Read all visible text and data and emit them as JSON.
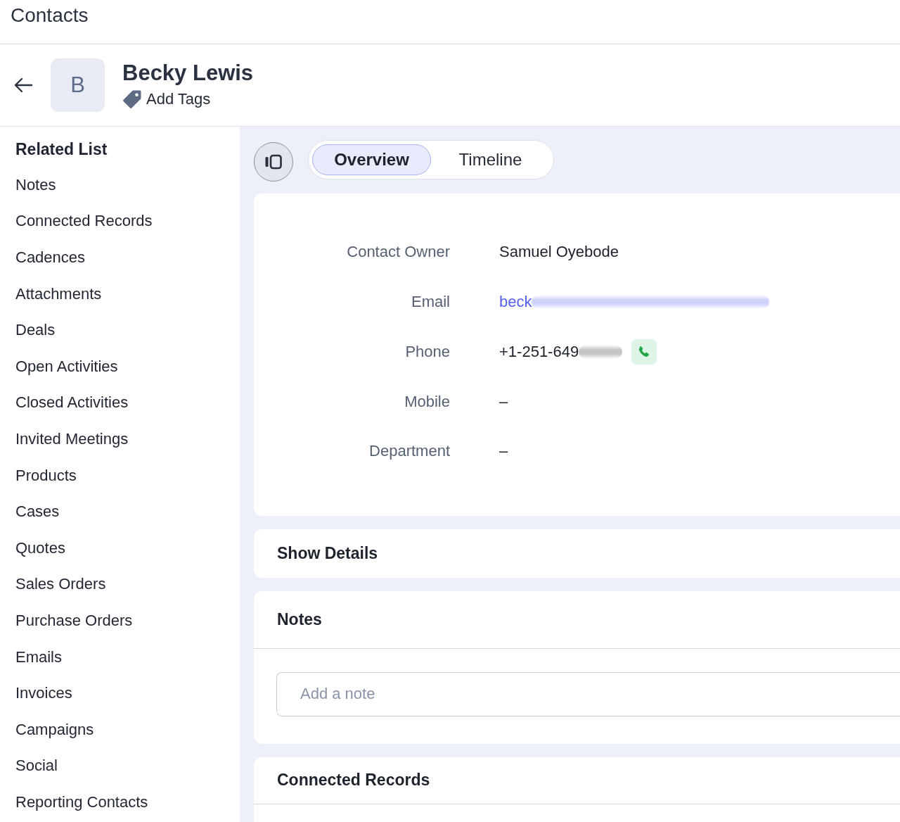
{
  "app_bar": {
    "title": "Contacts"
  },
  "record_header": {
    "avatar_initial": "B",
    "name": "Becky Lewis",
    "tags_link": "Add Tags"
  },
  "sidebar": {
    "heading": "Related List",
    "items": [
      "Notes",
      "Connected Records",
      "Cadences",
      "Attachments",
      "Deals",
      "Open Activities",
      "Closed Activities",
      "Invited Meetings",
      "Products",
      "Cases",
      "Quotes",
      "Sales Orders",
      "Purchase Orders",
      "Emails",
      "Invoices",
      "Campaigns",
      "Social",
      "Reporting Contacts"
    ]
  },
  "view_switch": {
    "tabs": [
      {
        "label": "Overview",
        "selected": true
      },
      {
        "label": "Timeline",
        "selected": false
      }
    ]
  },
  "overview": {
    "fields": [
      {
        "label": "Contact Owner",
        "value": "Samuel Oyebode",
        "kind": "text",
        "redacted": false
      },
      {
        "label": "Email",
        "value": "beck",
        "kind": "email",
        "redacted": true
      },
      {
        "label": "Phone",
        "value": "+1-251-649",
        "kind": "phone",
        "redacted": true
      },
      {
        "label": "Mobile",
        "value": "–",
        "kind": "text",
        "redacted": false
      },
      {
        "label": "Department",
        "value": "–",
        "kind": "text",
        "redacted": false
      }
    ]
  },
  "sections": [
    {
      "title": "Show Details",
      "kind": "collapsed"
    },
    {
      "title": "Notes",
      "kind": "notes",
      "placeholder": "Add a note"
    },
    {
      "title": "Connected Records",
      "kind": "list"
    }
  ]
}
